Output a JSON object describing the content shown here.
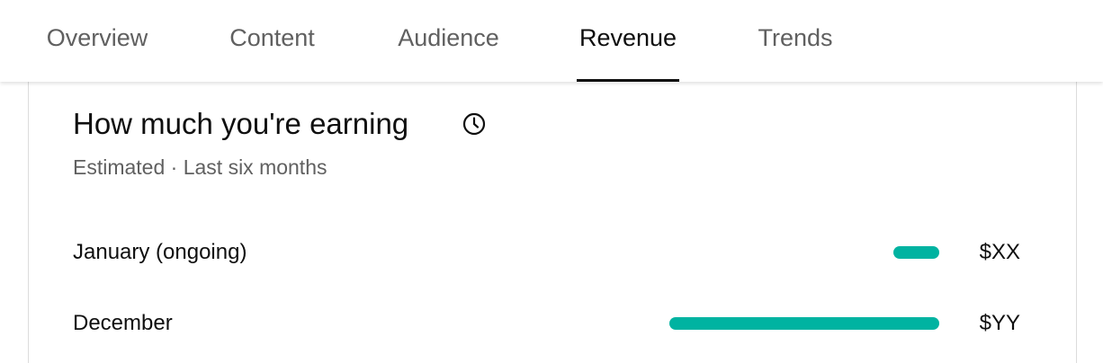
{
  "tabs": [
    {
      "label": "Overview",
      "active": false
    },
    {
      "label": "Content",
      "active": false
    },
    {
      "label": "Audience",
      "active": false
    },
    {
      "label": "Revenue",
      "active": true
    },
    {
      "label": "Trends",
      "active": false
    }
  ],
  "card": {
    "title": "How much you're earning",
    "title_icon": "clock-icon",
    "subtitle": "Estimated · Last six months"
  },
  "revenue_rows": [
    {
      "label": "January (ongoing)",
      "value": "$XX",
      "bar_fraction": 0.17
    },
    {
      "label": "December",
      "value": "$YY",
      "bar_fraction": 1.0
    }
  ],
  "colors": {
    "accent_bar": "#00b3a1",
    "active_tab_underline": "#0f0f0f",
    "inactive_tab_text": "#606060"
  }
}
